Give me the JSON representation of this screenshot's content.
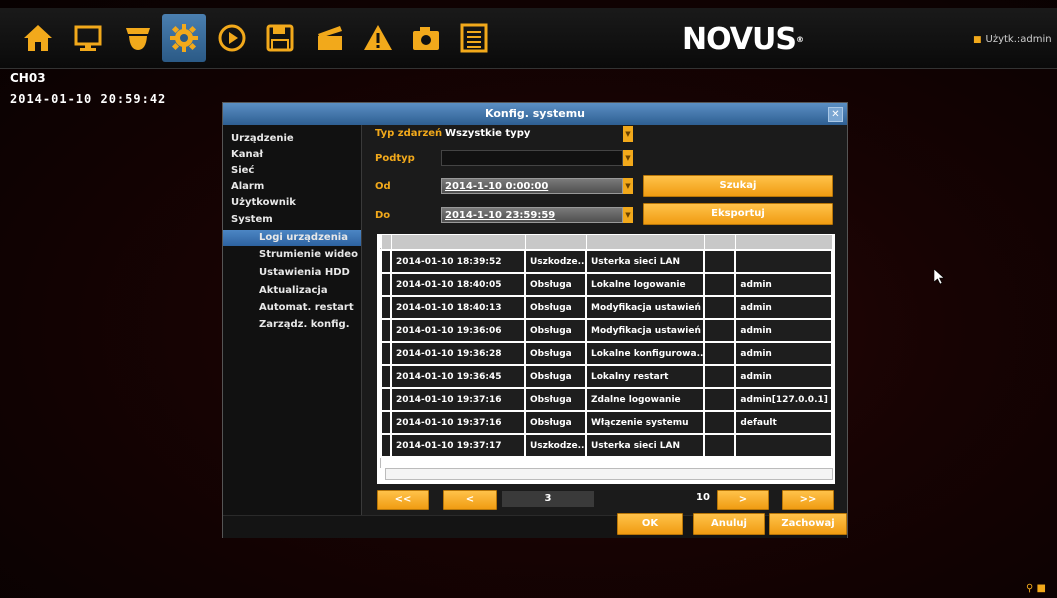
{
  "header": {
    "toolbar_icons": [
      {
        "name": "home-icon",
        "glyph": "⌂"
      },
      {
        "name": "monitor-icon",
        "glyph": "▭"
      },
      {
        "name": "ptz-camera-icon",
        "glyph": "▼"
      },
      {
        "name": "settings-gear-icon",
        "glyph": "⚙"
      },
      {
        "name": "playback-icon",
        "glyph": "▶"
      },
      {
        "name": "backup-save-icon",
        "glyph": "▣"
      },
      {
        "name": "record-clapper-icon",
        "glyph": "◤"
      },
      {
        "name": "alarm-warning-icon",
        "glyph": "▲"
      },
      {
        "name": "snapshot-camera-icon",
        "glyph": "◙"
      },
      {
        "name": "log-list-icon",
        "glyph": "▤"
      }
    ],
    "logo": "NOVUS",
    "user": "Użytk.:admin"
  },
  "overlay": {
    "channel": "CH03",
    "datetime": "2014-01-10 20:59:42"
  },
  "dialog": {
    "title": "Konfig. systemu",
    "close": "✕",
    "nav": {
      "items": [
        "Urządzenie",
        "Kanał",
        "Sieć",
        "Alarm",
        "Użytkownik",
        "System"
      ],
      "sub_items": [
        "Logi urządzenia",
        "Strumienie wideo",
        "Ustawienia HDD",
        "Aktualizacja",
        "Automat. restart",
        "Zarządz. konfig."
      ],
      "active_sub": "Logi urządzenia"
    },
    "form": {
      "event_type_label": "Typ zdarzeń",
      "event_type_value": "Wszystkie typy",
      "subtype_label": "Podtyp",
      "subtype_value": "",
      "from_label": "Od",
      "from_value": "2014-1-10 0:00:00",
      "to_label": "Do",
      "to_value": "2014-1-10 23:59:59",
      "search_button": "Szukaj",
      "export_button": "Eksportuj"
    },
    "table": {
      "rows": [
        {
          "time": "2014-01-10 18:39:52",
          "type": "Uszkodze..",
          "desc": "Usterka sieci LAN",
          "ch": "",
          "user": ""
        },
        {
          "time": "2014-01-10 18:40:05",
          "type": "Obsługa",
          "desc": "Lokalne logowanie",
          "ch": "",
          "user": "admin"
        },
        {
          "time": "2014-01-10 18:40:13",
          "type": "Obsługa",
          "desc": "Modyfikacja ustawień",
          "ch": "",
          "user": "admin"
        },
        {
          "time": "2014-01-10 19:36:06",
          "type": "Obsługa",
          "desc": "Modyfikacja ustawień",
          "ch": "",
          "user": "admin"
        },
        {
          "time": "2014-01-10 19:36:28",
          "type": "Obsługa",
          "desc": "Lokalne konfigurowa..",
          "ch": "",
          "user": "admin"
        },
        {
          "time": "2014-01-10 19:36:45",
          "type": "Obsługa",
          "desc": "Lokalny restart",
          "ch": "",
          "user": "admin"
        },
        {
          "time": "2014-01-10 19:37:16",
          "type": "Obsługa",
          "desc": "Zdalne logowanie",
          "ch": "",
          "user": "admin[127.0.0.1]"
        },
        {
          "time": "2014-01-10 19:37:16",
          "type": "Obsługa",
          "desc": "Włączenie systemu",
          "ch": "",
          "user": "default"
        },
        {
          "time": "2014-01-10 19:37:17",
          "type": "Uszkodze..",
          "desc": "Usterka sieci LAN",
          "ch": "",
          "user": ""
        }
      ]
    },
    "pager": {
      "first": "<<",
      "prev": "<",
      "current": "3",
      "total": "10",
      "next": ">",
      "last": ">>"
    },
    "footer": {
      "ok": "OK",
      "cancel": "Anuluj",
      "save": "Zachowaj"
    }
  },
  "colors": {
    "accent": "#f2a91b",
    "title_bar": "#3a6ea5",
    "background": "#1b1b1b"
  }
}
